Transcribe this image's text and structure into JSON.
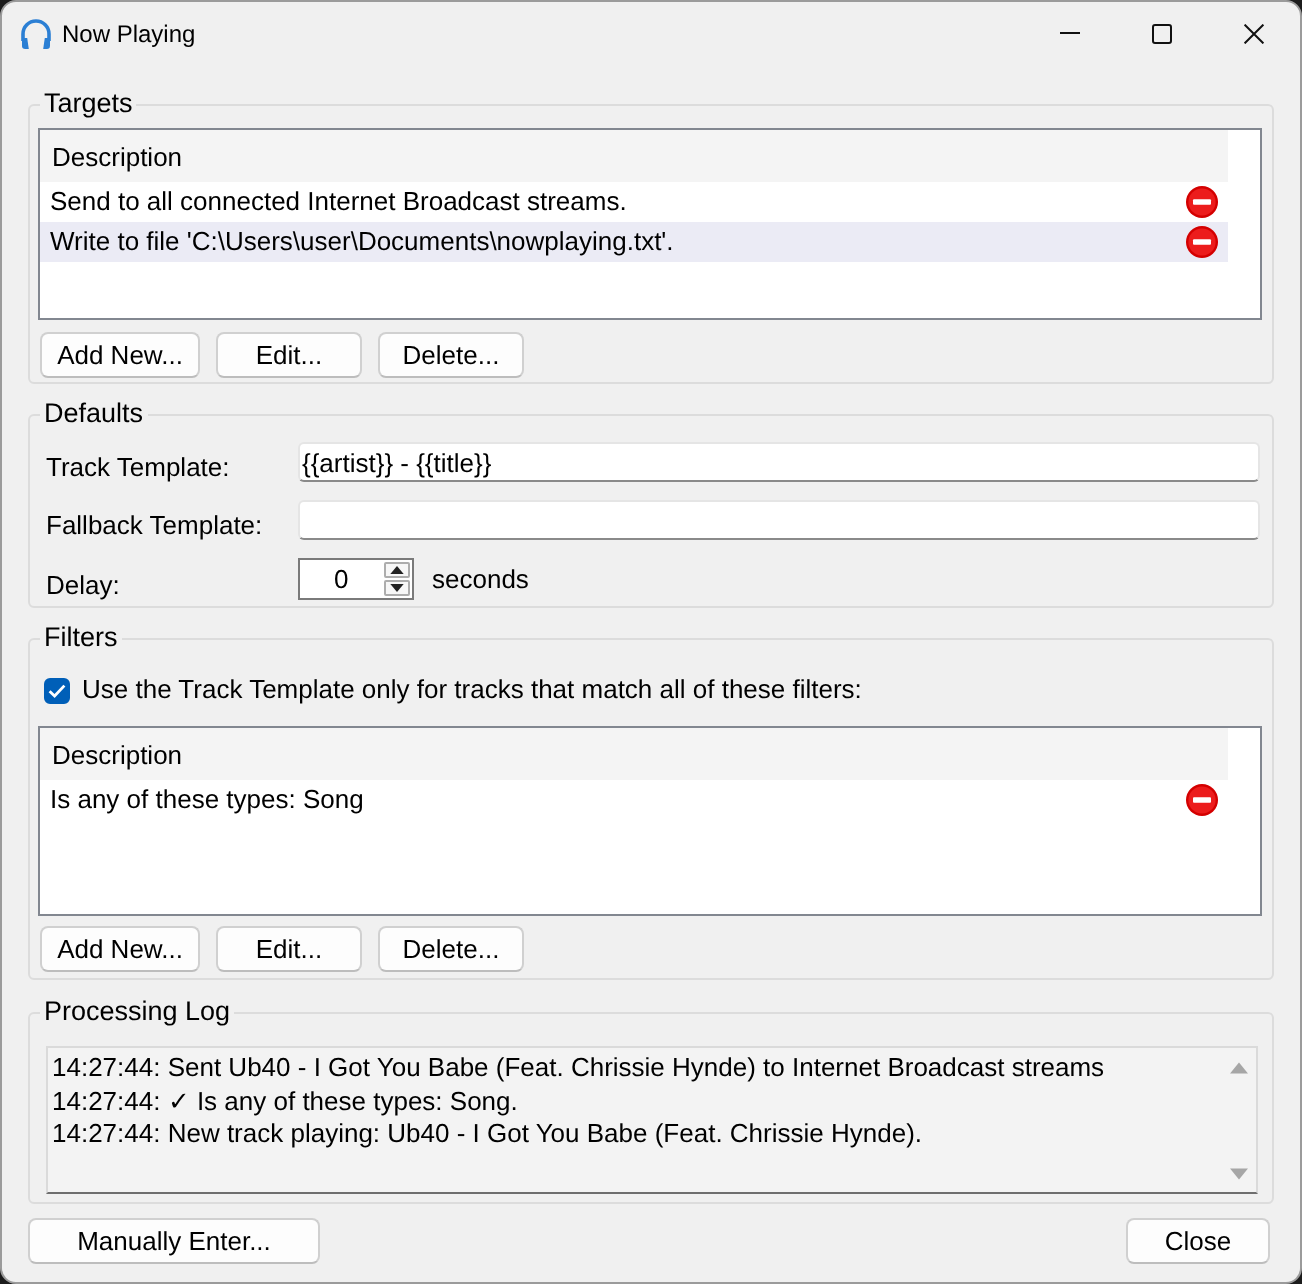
{
  "window": {
    "title": "Now Playing"
  },
  "targets": {
    "title": "Targets",
    "column": "Description",
    "rows": [
      {
        "description": "Send to all connected Internet Broadcast streams.",
        "selected": false
      },
      {
        "description": "Write to file 'C:\\Users\\user\\Documents\\nowplaying.txt'.",
        "selected": true
      }
    ],
    "buttons": [
      "Add New...",
      "Edit...",
      "Delete..."
    ]
  },
  "defaults": {
    "title": "Defaults",
    "fields": [
      {
        "kind": "text",
        "label": "Track Template:",
        "value": "{{artist}} - {{title}}"
      },
      {
        "kind": "text",
        "label": "Fallback Template:"
      },
      {
        "kind": "spin",
        "label": "Delay:",
        "value": "0",
        "unit": "seconds"
      }
    ]
  },
  "filters": {
    "title": "Filters",
    "checkbox": {
      "label": "Use the Track Template only for tracks that match all of these filters:",
      "checked": true
    },
    "column": "Description",
    "rows": [
      {
        "description": "Is any of these types: Song",
        "selected": false
      }
    ],
    "buttons": [
      "Add New...",
      "Edit...",
      "Delete..."
    ]
  },
  "processing_log": {
    "title": "Processing Log",
    "lines": [
      "14:27:44: Sent Ub40 - I Got You Babe (Feat. Chrissie Hynde) to Internet Broadcast streams",
      "14:27:44: ✓ Is any of these types: Song.",
      "14:27:44: New track playing: Ub40 - I Got You Babe (Feat. Chrissie Hynde)."
    ]
  },
  "footer": {
    "buttons": [
      "Manually Enter...",
      "Close"
    ]
  }
}
